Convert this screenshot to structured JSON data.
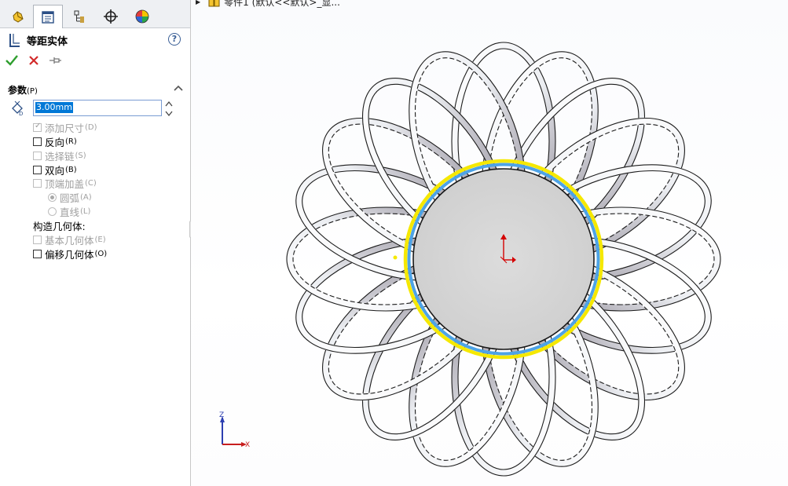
{
  "feature": {
    "title": "等距实体",
    "help": "?"
  },
  "tree": {
    "crumb": "零件1 (默认<<默认>_显..."
  },
  "section": {
    "label": "参数",
    "mnemonic": "(P)"
  },
  "distance": {
    "value": "3.00mm"
  },
  "options": [
    {
      "label": "添加尺寸",
      "key": "(D)",
      "checked": true,
      "enabled": false
    },
    {
      "label": "反向",
      "key": "(R)",
      "checked": false,
      "enabled": true
    },
    {
      "label": "选择链",
      "key": "(S)",
      "checked": false,
      "enabled": false
    },
    {
      "label": "双向",
      "key": "(B)",
      "checked": false,
      "enabled": true
    },
    {
      "label": "顶端加盖",
      "key": "(C)",
      "checked": false,
      "enabled": false
    }
  ],
  "cap_types": [
    {
      "label": "圆弧",
      "key": "(A)",
      "selected": true
    },
    {
      "label": "直线",
      "key": "(L)",
      "selected": false
    }
  ],
  "construction": {
    "label": "构造几何体:",
    "options": [
      {
        "label": "基本几何体",
        "key": "(E)",
        "checked": false,
        "enabled": false
      },
      {
        "label": "偏移几何体",
        "key": "(O)",
        "checked": false,
        "enabled": true
      }
    ]
  },
  "triad": {
    "z_label": "Z",
    "x_label": "X"
  },
  "colors": {
    "selection_yellow": "#f5e800",
    "offset_blue": "#4da3e6",
    "confirm_green": "#2e9e2e",
    "cancel_red": "#d22a2a"
  }
}
